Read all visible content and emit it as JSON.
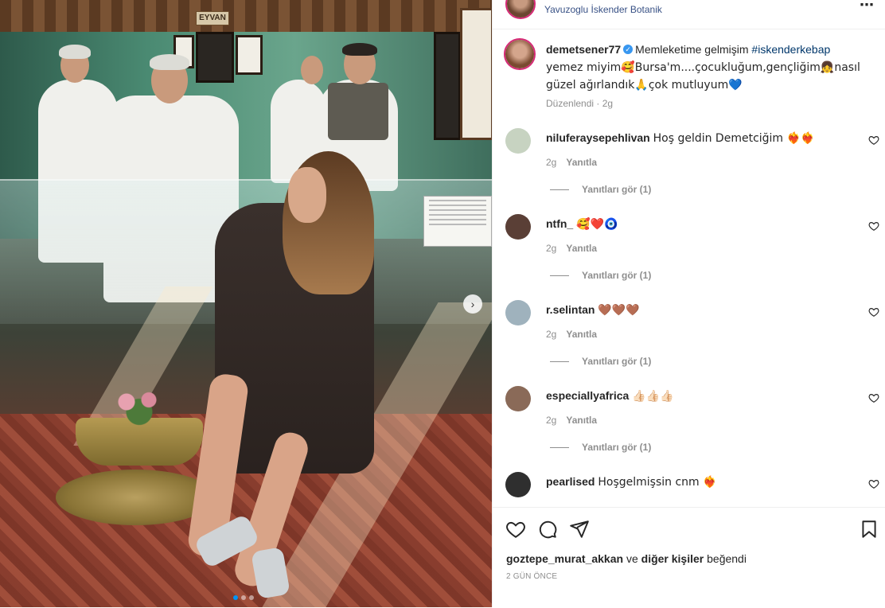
{
  "post": {
    "location": "Yavuzoglu İskender Botanik",
    "more_icon": "⋯",
    "media": {
      "sign_text": "EYVAN",
      "next_icon": "›",
      "carousel_count": 3,
      "carousel_active": 1
    },
    "caption": {
      "username": "demetsener77",
      "verified_icon": "✓",
      "text_part1": "Memleketime gelmişim ",
      "hashtag": "#iskenderkebap",
      "text_part2": " yemez miyim🥰Bursa'm....çocukluğum,gençliğim👧nasıl güzel ağırlandık🙏çok mutluyum💙"
    },
    "edited": "Düzenlendi · 2g",
    "comments": [
      {
        "username": "niluferaysepehlivan",
        "text": "Hoş geldin Demetciğim ❤️‍🔥❤️‍🔥",
        "age": "2g",
        "reply": "Yanıtla",
        "replies": "Yanıtları gör (1)",
        "avatar_color": "#c7d3c1"
      },
      {
        "username": "ntfn_",
        "text": "🥰❤️🧿",
        "age": "2g",
        "reply": "Yanıtla",
        "replies": "Yanıtları gör (1)",
        "avatar_color": "#5a3f36"
      },
      {
        "username": "r.selintan",
        "text": "🤎🤎🤎",
        "age": "2g",
        "reply": "Yanıtla",
        "replies": "Yanıtları gör (1)",
        "avatar_color": "#9fb2bd"
      },
      {
        "username": "especiallyafrica",
        "text": "👍🏻👍🏻👍🏻",
        "age": "2g",
        "reply": "Yanıtla",
        "replies": "Yanıtları gör (1)",
        "avatar_color": "#8a6a58"
      },
      {
        "username": "pearlised",
        "text": "Hoşgelmişsin cnm ❤️‍🔥",
        "age": "",
        "reply": "",
        "replies": "",
        "avatar_color": "#2f2f2f"
      }
    ],
    "likes": {
      "user": "goztepe_murat_akkan",
      "joiner": " ve ",
      "others": "diğer kişiler",
      "suffix": " beğendi"
    },
    "timestamp": "2 GÜN ÖNCE"
  },
  "colors": {
    "link": "#385185",
    "hashtag": "#00376b",
    "muted": "#8e8e8e",
    "verified": "#3897f0",
    "carousel_active": "#0095f6"
  },
  "icons": [
    "heart-icon",
    "comment-icon",
    "share-icon",
    "bookmark-icon",
    "more-icon",
    "chevron-right-icon",
    "verified-badge-icon"
  ]
}
